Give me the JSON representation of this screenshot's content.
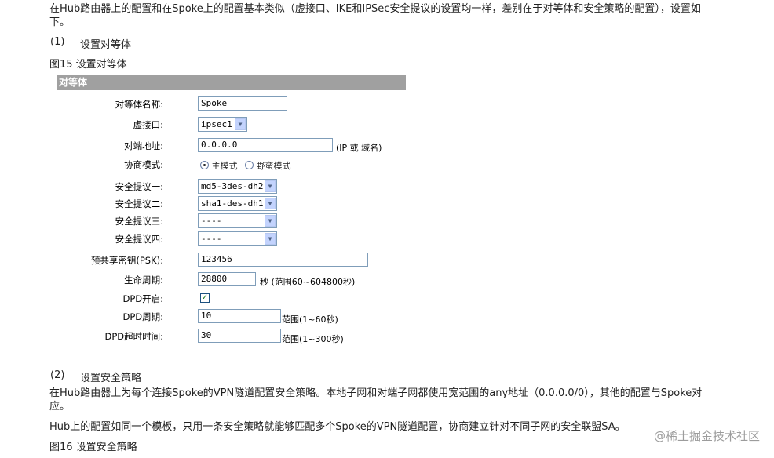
{
  "intro": {
    "line1": "在Hub路由器上的配置和在Spoke上的配置基本类似（虚接口、IKE和IPSec安全提议的设置均一样，差别在于对等体和安全策略的配置），设置如",
    "line2": "下。"
  },
  "step1": {
    "num": "(1)",
    "title": "设置对等体"
  },
  "figure15": {
    "caption": "图15 设置对等体"
  },
  "panel": {
    "header": "对等体",
    "peer_name_label": "对等体名称:",
    "peer_name_value": "Spoke",
    "virtual_if_label": "虚接口:",
    "virtual_if_value": "ipsec1",
    "remote_addr_label": "对端地址:",
    "remote_addr_value": "0.0.0.0",
    "remote_addr_hint": "(IP 或 域名)",
    "mode_label": "协商模式:",
    "mode_main": "主模式",
    "mode_aggressive": "野蛮模式",
    "proposal1_label": "安全提议一:",
    "proposal1_value": "md5-3des-dh2",
    "proposal2_label": "安全提议二:",
    "proposal2_value": "sha1-des-dh1",
    "proposal3_label": "安全提议三:",
    "proposal3_value": "----",
    "proposal4_label": "安全提议四:",
    "proposal4_value": "----",
    "psk_label": "预共享密钥(PSK):",
    "psk_value": "123456",
    "lifetime_label": "生命周期:",
    "lifetime_value": "28800",
    "lifetime_hint": "秒 (范围60~604800秒)",
    "dpd_enable_label": "DPD开启:",
    "dpd_enabled": true,
    "dpd_period_label": "DPD周期:",
    "dpd_period_value": "10",
    "dpd_period_hint": "范围(1~60秒)",
    "dpd_timeout_label": "DPD超时时间:",
    "dpd_timeout_value": "30",
    "dpd_timeout_hint": "范围(1~300秒)"
  },
  "step2": {
    "num": "(2)",
    "title": "设置安全策略"
  },
  "para2": {
    "line1": "在Hub路由器上为每个连接Spoke的VPN隧道配置安全策略。本地子网和对端子网都使用宽范围的any地址（0.0.0.0/0），其他的配置与Spoke对",
    "line2": "应。"
  },
  "para3": "Hub上的配置如同一个模板，只用一条安全策略就能够匹配多个Spoke的VPN隧道配置，协商建立针对不同子网的安全联盟SA。",
  "figure16": {
    "caption": "图16 设置安全策略"
  },
  "watermark": "@稀土掘金技术社区",
  "icons": {
    "dropdown": "chevron-down-icon",
    "check": "check-icon",
    "radio": "radio-icon"
  }
}
